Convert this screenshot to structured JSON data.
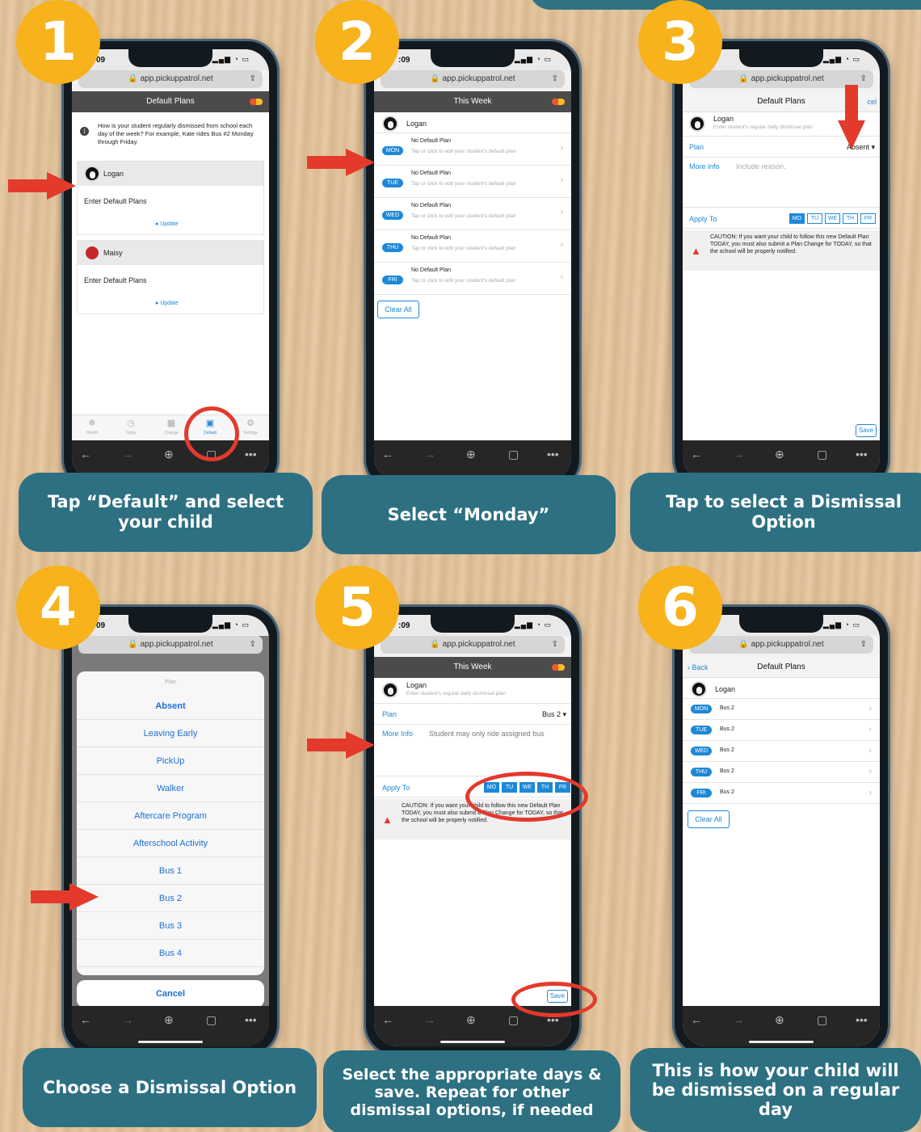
{
  "steps": [
    {
      "num": "1",
      "caption": "Tap “Default” and select your child"
    },
    {
      "num": "2",
      "caption": "Select “Monday”"
    },
    {
      "num": "3",
      "caption": "Tap to select a Dismissal Option"
    },
    {
      "num": "4",
      "caption": "Choose a Dismissal Option"
    },
    {
      "num": "5",
      "caption": "Select the appropriate days & save. Repeat for other dismissal options, if needed"
    },
    {
      "num": "6",
      "caption": "This is how your child will be dismissed on a regular day"
    }
  ],
  "url": "app.pickuppatrol.net",
  "s1": {
    "time": "09",
    "header": "Default Plans",
    "info": "How is your student regularly dismissed from school each day of the week? For example, Kate rides Bus #2 Monday through Friday.",
    "children": [
      {
        "name": "Logan",
        "prompt": "Enter Default Plans",
        "update": "Update"
      },
      {
        "name": "Maisy",
        "prompt": "Enter Default Plans",
        "update": "Update"
      }
    ],
    "tabs": [
      "Health",
      "Today",
      "Change",
      "Default",
      "Settings"
    ]
  },
  "s2": {
    "time": ":09",
    "header": "This Week",
    "child": "Logan",
    "days": [
      "MON",
      "TUE",
      "WED",
      "THU",
      "FRI"
    ],
    "no_plan": "No Default Plan",
    "hint": "Tap or click to edit your student's default plan",
    "clear": "Clear All"
  },
  "s3": {
    "header": "Default Plans",
    "cancel": "cel",
    "child": "Logan",
    "sub": "Enter student's regular daily dismissal plan",
    "plan_label": "Plan",
    "plan_value": "Absent",
    "more_label": "More info",
    "more_ph": "Include reason.",
    "apply": "Apply To",
    "days": [
      "MO",
      "TU",
      "WE",
      "TH",
      "FR"
    ],
    "caution": "CAUTION: If you want your child to follow this new Default Plan TODAY, you must also submit a Plan Change for TODAY, so that the school will be properly notified.",
    "save": "Save"
  },
  "s4": {
    "time": "09",
    "title": "Plan",
    "options": [
      "Absent",
      "Leaving Early",
      "PickUp",
      "Walker",
      "Aftercare Program",
      "Afterschool Activity",
      "Bus 1",
      "Bus 2",
      "Bus 3",
      "Bus 4"
    ],
    "cancel": "Cancel"
  },
  "s5": {
    "time": ":09",
    "header": "This Week",
    "child": "Logan",
    "sub": "Enter student's regular daily dismissal plan",
    "plan_label": "Plan",
    "plan_value": "Bus 2",
    "more_label": "More Info",
    "more_value": "Student may only ride assigned bus",
    "apply": "Apply To",
    "days": [
      "MO",
      "TU",
      "WE",
      "TH",
      "FR"
    ],
    "caution": "CAUTION: If you want your child to follow this new Default Plan TODAY, you must also submit a Plan Change for TODAY, so that the school will be properly notified.",
    "save": "Save"
  },
  "s6": {
    "back": "Back",
    "header": "Default Plans",
    "child": "Logan",
    "days": [
      "MON",
      "TUE",
      "WED",
      "THU",
      "FRI"
    ],
    "plan": "Bus 2",
    "clear": "Clear All"
  }
}
